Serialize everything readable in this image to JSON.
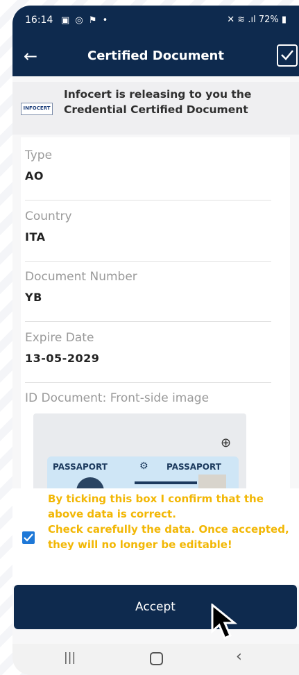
{
  "status_bar": {
    "time": "16:14",
    "left_icons": "▣ ◎ ⚑ •",
    "right_text": "✕ ≋ .ıl 72% ▮"
  },
  "app_bar": {
    "title": "Certified Document",
    "back_icon": "←"
  },
  "banner": {
    "logo_text": "INFOCERT",
    "message": "Infocert is releasing to you the Credential Certified Document"
  },
  "fields": [
    {
      "label": "Type",
      "value": "AO"
    },
    {
      "label": "Country",
      "value": "ITA"
    },
    {
      "label": "Document Number",
      "value": "YB"
    },
    {
      "label": "Expire Date",
      "value": "13-05-2029"
    }
  ],
  "id_image": {
    "label": "ID Document: Front-side image",
    "passport_left": "PASSAPORT",
    "passport_right": "PASSAPORT",
    "zoom_icon": "⊕"
  },
  "confirmation": {
    "checked": true,
    "text_line1": "By ticking this box I confirm that the above data is correct.",
    "text_line2": "Check carefully the data. Once accepted, they will no longer be editable!"
  },
  "accept_button": {
    "label": "Accept"
  },
  "nav_bar": {
    "recent_icon": "|||",
    "home_icon": "○",
    "back_icon": "‹"
  },
  "colors": {
    "primary": "#0e2a4e",
    "warning_text": "#f2b705",
    "checkbox": "#1e78d7"
  }
}
